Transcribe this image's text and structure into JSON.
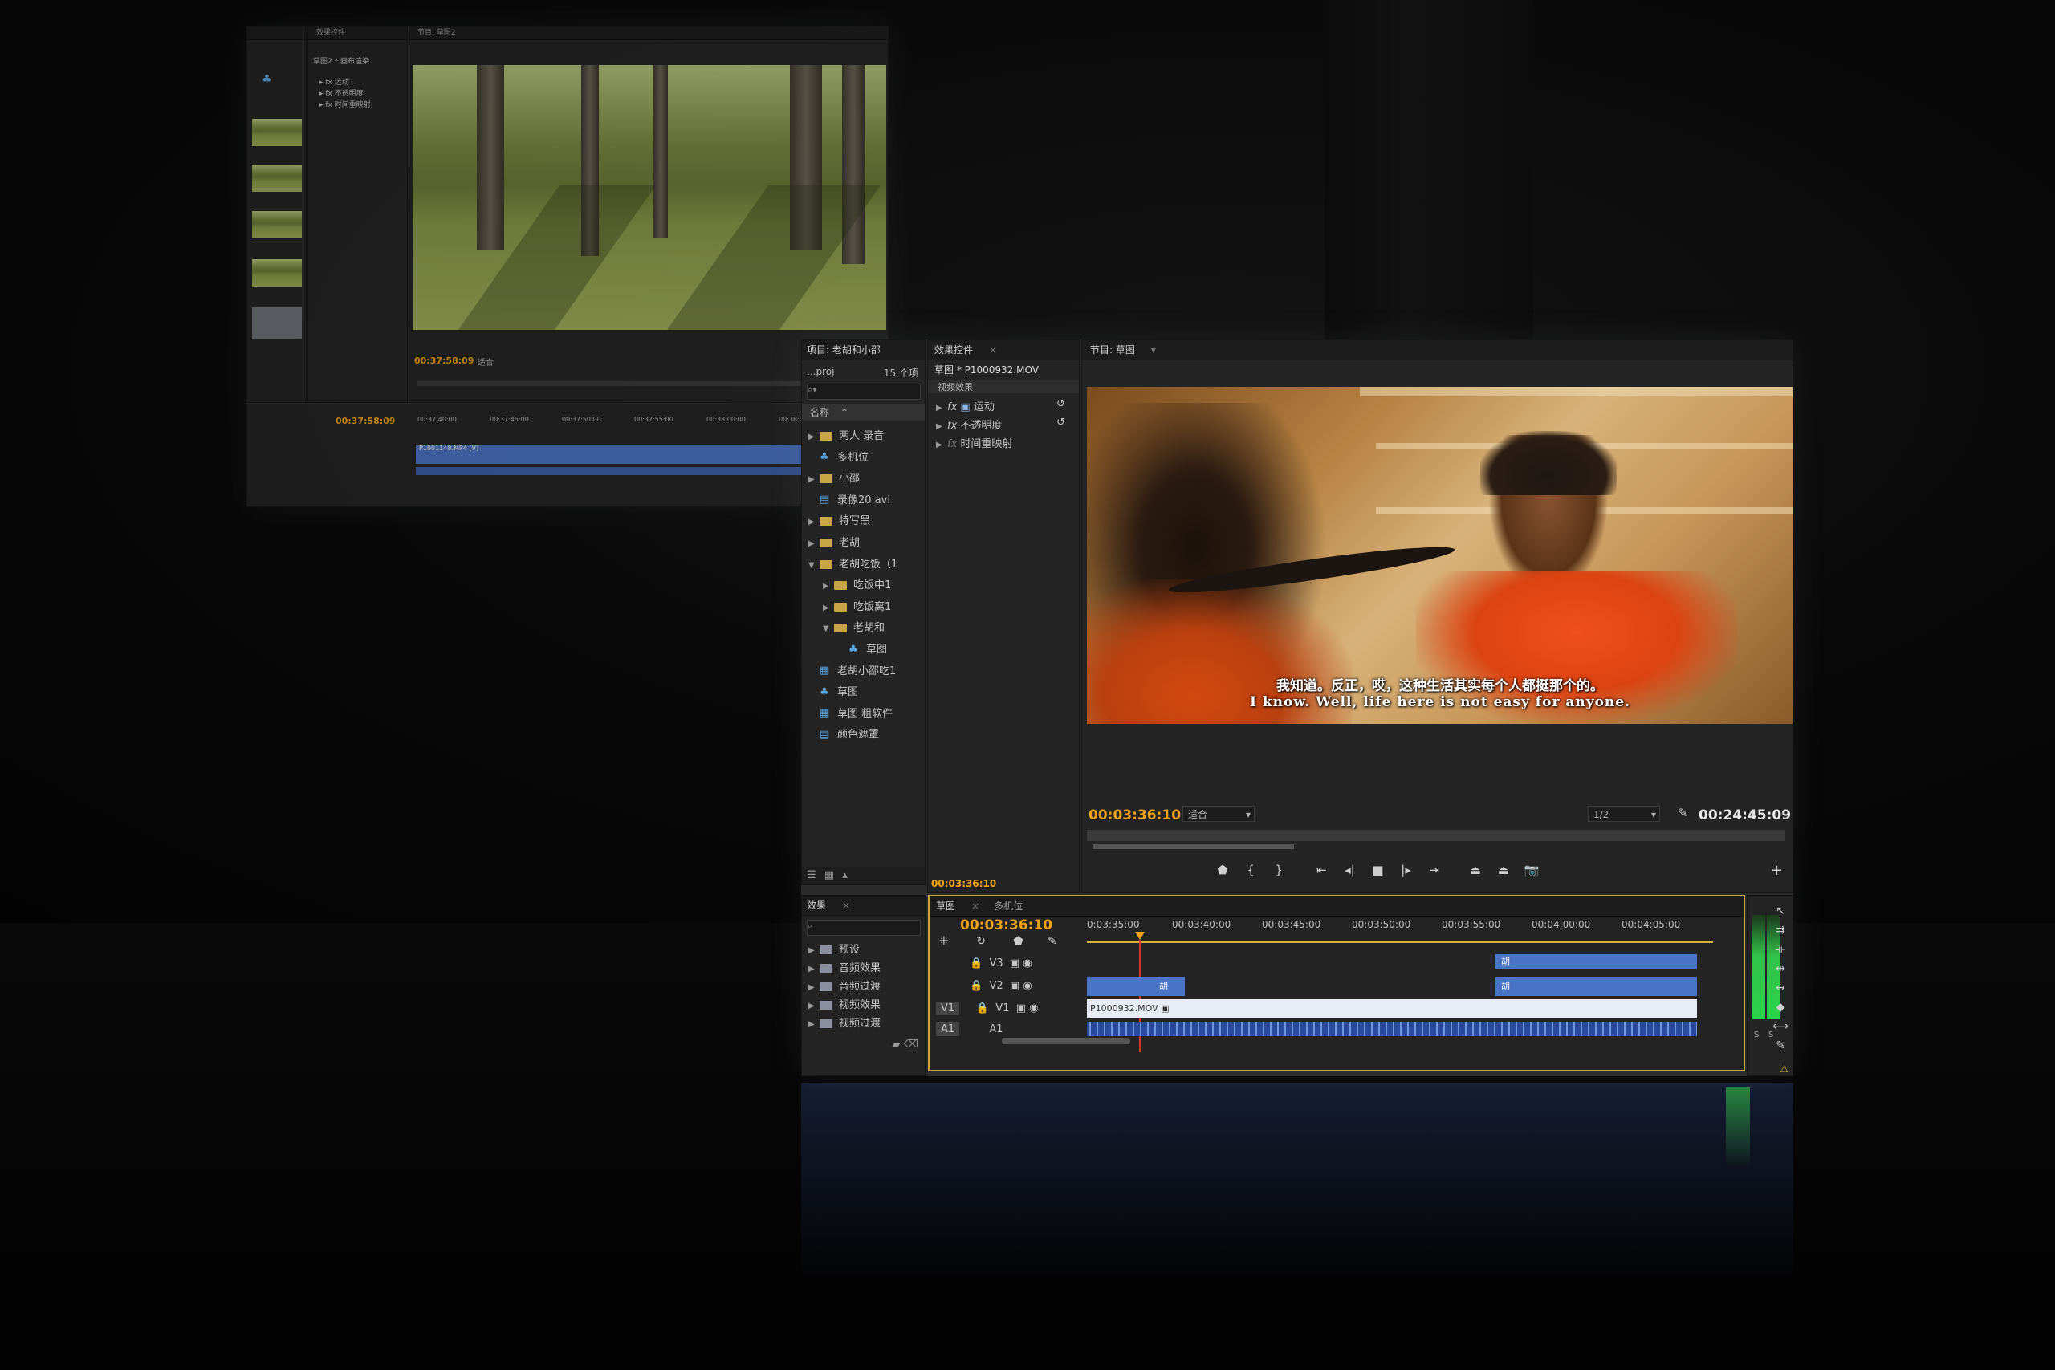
{
  "colors": {
    "accent_timecode": "#f0a218",
    "clip_blue": "#4a74c6",
    "panel": "#242424"
  },
  "back_screen": {
    "tabs": [
      "效果控件",
      "节目: 草图2"
    ],
    "effects_header": "草图2 * 画布渲染",
    "effects": [
      "运动",
      "不透明度",
      "时间重映射"
    ],
    "timecode_in": "00:37:58:09",
    "fit": "适合",
    "timeline_timecode": "00:37:58:09",
    "ruler": [
      "00:37:40:00",
      "00:37:45:00",
      "00:37:50:00",
      "00:37:55:00",
      "00:38:00:00",
      "00:38:05:00"
    ],
    "clip_name": "P1001148.MP4 [V]"
  },
  "project": {
    "tab": "项目: 老胡和小邵",
    "proj_name": "...proj",
    "count": "15 个项",
    "header": "名称",
    "items": [
      {
        "type": "folder",
        "label": "两人 录音",
        "indent": 0,
        "tri": "▶"
      },
      {
        "type": "seq",
        "label": "多机位",
        "indent": 0,
        "tri": ""
      },
      {
        "type": "folder",
        "label": "小邵",
        "indent": 0,
        "tri": "▶"
      },
      {
        "type": "file",
        "label": "录像20.avi",
        "indent": 0,
        "tri": ""
      },
      {
        "type": "folder",
        "label": "特写黑",
        "indent": 0,
        "tri": "▶"
      },
      {
        "type": "folder",
        "label": "老胡",
        "indent": 0,
        "tri": "▶"
      },
      {
        "type": "folder",
        "label": "老胡吃饭（1",
        "indent": 0,
        "tri": "▼"
      },
      {
        "type": "folder",
        "label": "吃饭中1",
        "indent": 1,
        "tri": "▶"
      },
      {
        "type": "folder",
        "label": "吃饭离1",
        "indent": 1,
        "tri": "▶"
      },
      {
        "type": "folder",
        "label": "老胡和",
        "indent": 1,
        "tri": "▼"
      },
      {
        "type": "seq",
        "label": "草图",
        "indent": 2,
        "tri": ""
      },
      {
        "type": "clip",
        "label": "老胡小邵吃1",
        "indent": 0,
        "tri": ""
      },
      {
        "type": "seq",
        "label": "草图",
        "indent": 0,
        "tri": ""
      },
      {
        "type": "clip",
        "label": "草图 粗软件",
        "indent": 0,
        "tri": ""
      },
      {
        "type": "file",
        "label": "颜色遮罩",
        "indent": 0,
        "tri": ""
      }
    ]
  },
  "effect_controls": {
    "tab": "效果控件",
    "clip": "草图 * P1000932.MOV",
    "section": "视频效果",
    "effects": [
      "运动",
      "不透明度",
      "时间重映射"
    ],
    "timecode": "00:03:36:10"
  },
  "program": {
    "tab": "节目: 草图",
    "subtitle_cn": "我知道。反正，哎，这种生活其实每个人都挺那个的。",
    "subtitle_en": "I know. Well, life here is not easy for anyone.",
    "timecode": "00:03:36:10",
    "fit": "适合",
    "resolution": "1/2",
    "duration": "00:24:45:09"
  },
  "effects_panel": {
    "tab": "效果",
    "items": [
      "预设",
      "音频效果",
      "音频过渡",
      "视频效果",
      "视频过渡"
    ]
  },
  "timeline": {
    "tabs": [
      "草图",
      "多机位"
    ],
    "timecode": "00:03:36:10",
    "ruler": [
      "0:03:35:00",
      "00:03:40:00",
      "00:03:45:00",
      "00:03:50:00",
      "00:03:55:00",
      "00:04:00:00",
      "00:04:05:00"
    ],
    "tracks": [
      "V3",
      "V2",
      "V1",
      "A1"
    ],
    "source_v1": "V1",
    "source_a1": "A1",
    "clip_v2_a": "胡",
    "clip_v2_b": "胡",
    "clip_v3": "胡",
    "clip_v1": "P1000932.MOV",
    "meter_labels": [
      "S",
      "S"
    ]
  }
}
